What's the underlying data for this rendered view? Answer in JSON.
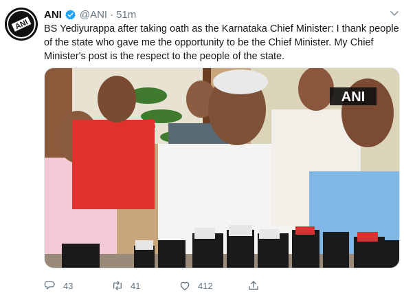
{
  "tweet": {
    "author_name": "ANI",
    "handle": "@ANI",
    "separator": "·",
    "time": "51m",
    "text": "BS Yediyurappa after taking oath as the Karnataka Chief Minister: I thank people of the state who gave me the opportunity to be the Chief Minister. My Chief Minister's post is the respect to the people of the state.",
    "media_watermark": "ANI"
  },
  "actions": {
    "replies": "43",
    "retweets": "41",
    "likes": "412"
  },
  "icons": {
    "avatar": "ani-logo",
    "verified": "verified-badge-icon",
    "menu": "chevron-down-icon",
    "reply": "reply-icon",
    "retweet": "retweet-icon",
    "like": "heart-icon",
    "share": "share-icon"
  },
  "colors": {
    "accent": "#1da1f2",
    "secondary_text": "#657786"
  }
}
